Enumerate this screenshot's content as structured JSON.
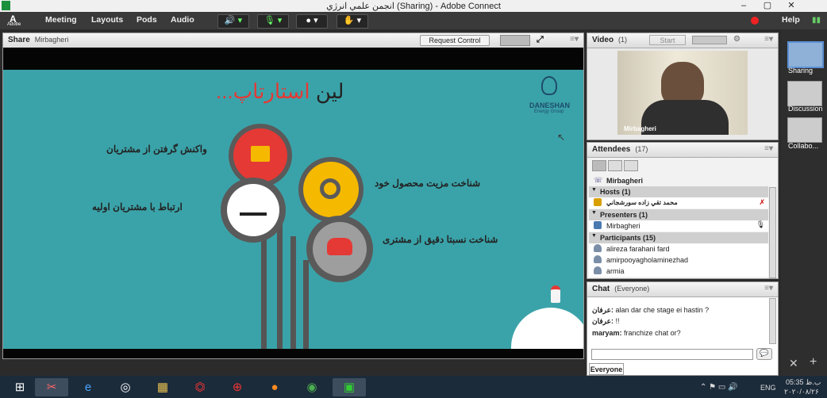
{
  "window": {
    "title": "انجمن علمي انرژي (Sharing) - Adobe Connect",
    "app_icon": "adobe-icon",
    "app_label": "Adobe"
  },
  "menubar": {
    "items": [
      "Meeting",
      "Layouts",
      "Pods",
      "Audio"
    ],
    "help": "Help"
  },
  "share_pod": {
    "title": "Share",
    "presenter": "Mirbagheri",
    "request_control": "Request Control"
  },
  "slide": {
    "title_black": "لین",
    "title_red": "استارتاپ...",
    "logo_text": "DANESHAN",
    "logo_sub": "Energy Group",
    "items": [
      "واکنش گرفتن از مشتریان",
      "شناخت مزیت محصول خود",
      "ارتباط با مشتریان اولیه",
      "شناخت نسبتا دقیق از مشتری"
    ]
  },
  "video_pod": {
    "title": "Video",
    "count": "(1)",
    "start": "Start",
    "camera_label": "Mirbagheri"
  },
  "attendees_pod": {
    "title": "Attendees",
    "count": "(17)",
    "me": "Mirbagheri",
    "sections": {
      "hosts": "Hosts (1)",
      "presenters": "Presenters (1)",
      "participants": "Participants (15)"
    },
    "host_name": "محمد تقي زاده سورشجاني",
    "presenter_name": "Mirbagheri",
    "participants": [
      "alireza farahani fard",
      "amirpooyagholaminezhad",
      "armia"
    ]
  },
  "chat_pod": {
    "title": "Chat",
    "scope": "(Everyone)",
    "messages": [
      {
        "sender": "عرفان:",
        "text": "alan dar che stage ei hastin ?"
      },
      {
        "sender": "عرفان:",
        "text": "!!"
      },
      {
        "sender": "maryam:",
        "text": "franchize  chat or?"
      }
    ],
    "tab": "Everyone"
  },
  "layouts": [
    "Sharing",
    "Discussion",
    "Collabo..."
  ],
  "taskbar": {
    "time": "05:35 ب.ظ",
    "date": "۲۰۲۰/۰۸/۲۶",
    "lang": "ENG"
  },
  "colors": {
    "slide_bg": "#3aa3a9",
    "red_disk": "#e53935",
    "yellow_disk": "#f5b900",
    "gray_disk": "#9e9e9e"
  }
}
